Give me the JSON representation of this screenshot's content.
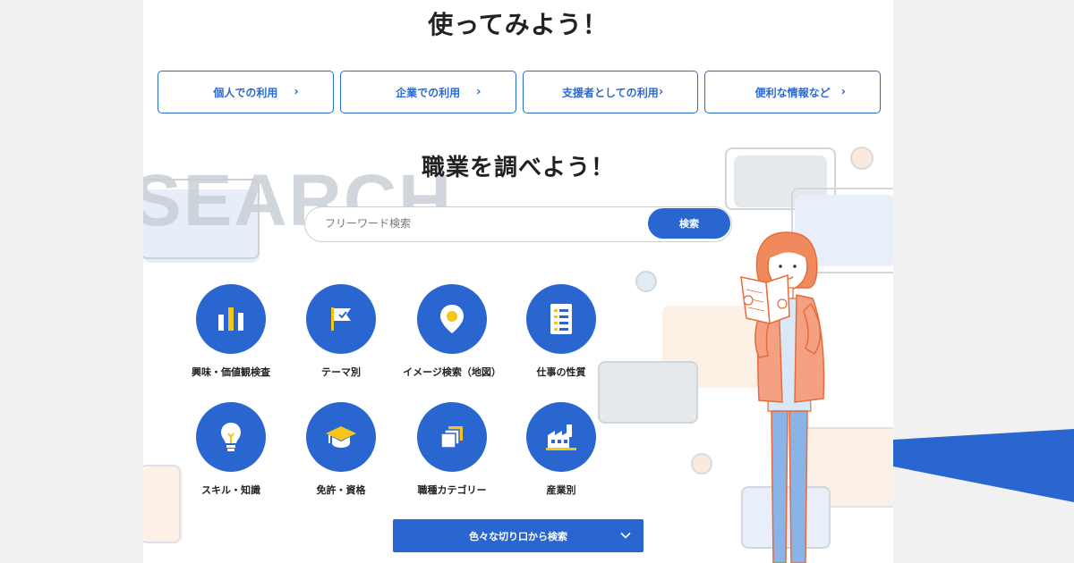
{
  "sections": {
    "use_title": "使ってみよう！",
    "search_title": "職業を調べよう！",
    "bg_word": "SEARCH"
  },
  "usage_buttons": [
    {
      "label": "個人での利用"
    },
    {
      "label": "企業での利用"
    },
    {
      "label": "支援者としての利用"
    },
    {
      "label": "便利な情報など"
    }
  ],
  "search": {
    "placeholder": "フリーワード検索",
    "button_label": "検索"
  },
  "categories": [
    {
      "label": "興味・価値観検査",
      "icon": "bar-chart-icon"
    },
    {
      "label": "テーマ別",
      "icon": "flag-icon"
    },
    {
      "label": "イメージ検索（地図）",
      "icon": "map-pin-icon"
    },
    {
      "label": "仕事の性質",
      "icon": "checklist-icon"
    },
    {
      "label": "スキル・知識",
      "icon": "lightbulb-icon"
    },
    {
      "label": "免許・資格",
      "icon": "graduation-cap-icon"
    },
    {
      "label": "職種カテゴリー",
      "icon": "stacked-squares-icon"
    },
    {
      "label": "産業別",
      "icon": "factory-icon"
    }
  ],
  "multi_search": {
    "label": "色々な切り口から検索"
  },
  "colors": {
    "accent": "#2a66cf",
    "icon_yellow": "#f5c518",
    "illustration_orange": "#f08a5d"
  }
}
